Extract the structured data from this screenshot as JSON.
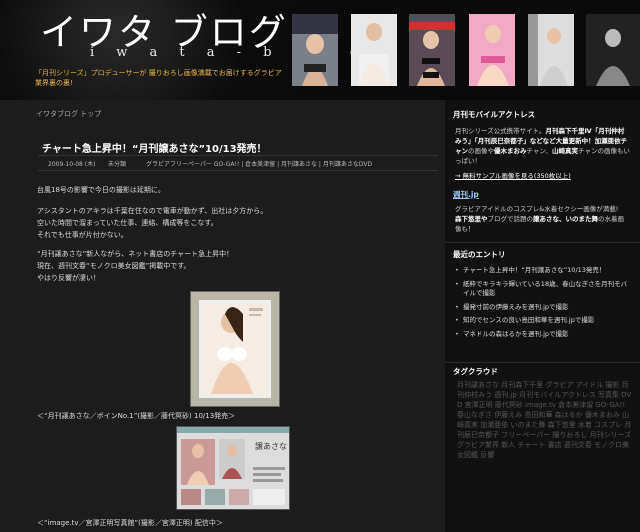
{
  "header": {
    "title": "イワタ ブログ",
    "subtitle": "i w a t a - b l o g",
    "description": "「月刊シリーズ」プロデューサーが 撮りおろし画像満載でお届けするグラビア業界裏の裏!"
  },
  "breadcrumb": "イワタブログ トップ",
  "post": {
    "title": "チャート急上昇中！“月刊譲あさな”10/13発売！",
    "date": "2009-10-08 (木)",
    "category": "未分類",
    "tags": "グラビアフリーペーパー GO-GA!! | 倉本美津留 | 月刊譲あさな | 月刊譲あさなDVD",
    "paragraphs": [
      "台風18号の影響で今日の撮影は延期に。",
      "アシスタントのアキラは千葉在住なので電車が動かず、出社は夕方から。",
      "空いた時間で溜まっていた仕事、連絡、構成等をこなす。",
      "それでも仕事が片付かない。",
      "“月刊譲あさな”新人ながら、ネット書店のチャート急上昇中！",
      "現在、週刊文春“モノクロ美女図鑑”掲載中です。",
      "やはり反響が凄い！"
    ],
    "caption1": "＜“月刊譲あさな／ボインNo.1”(撮影／藤代冥砂) 10/13発売＞",
    "caption2": "＜“image.tv／宮澤正明写真館”(撮影／宮澤正明) 配信中＞",
    "screenshot_name": "譲あさな"
  },
  "sidebar": {
    "mobile_heading": "月刊モバイルアクトレス",
    "mobile_text_1": "月刊シリーズ公式携帯サイト。",
    "mobile_text_bold": "月刊森下千里Ⅳ「月刊仲村みう」「月刊辰巳奈都子」などなど大量更新中！加瀬亜依チャン",
    "mobile_text_2": "の画像や",
    "mobile_text_bold2": "優木まおみ",
    "mobile_text_3": "チャン、",
    "mobile_text_bold3": "山崎真実",
    "mobile_text_4": "チャンの画像もいっぱい！",
    "mobile_link": "→ 無料サンプル画像を見る(350枚以上)",
    "weekly_link": "週刊.jp",
    "weekly_text_1": "グラビアアイドルのコスプレ&水着セクシー画像が満載!",
    "weekly_text_bold": "森下悠里や",
    "weekly_text_2": "ブログで話題の",
    "weekly_text_bold2": "譲あさな、いのまた舞",
    "weekly_text_3": "の水着画像も！",
    "recent_heading": "最近のエントリ",
    "recent": [
      "チャート急上昇中！“月刊譲あさな”10/13発売！",
      "紙粋でキラキラ輝いている18歳、春山なぎさを月刊モバイルで撮影",
      "撮発寸前の伊藤えみを週刊.jpで撮影",
      "知的でセンスの良い島田和華を週刊.jpで撮影",
      "マネドルの森はるかを週刊.jpで撮影"
    ],
    "tag_heading": "タグクラウド",
    "tagcloud": "月刊譲あさな 月刊森下千里 グラビア アイドル 撮影 月刊仲村みう 週刊.jp 月刊モバイルアクトレス 写真集 DVD 宮澤正明 藤代冥砂 image.tv 倉本美津留 GO-GA!! 春山なぎさ 伊藤えみ 島田和華 森はるか 優木まおみ 山崎真実 加瀬亜依 いのまた舞 森下悠里 水着 コスプレ 月刊辰巳奈都子 フリーペーパー 撮りおろし 月刊シリーズ グラビア業界 新人 チャート 書店 週刊文春 モノクロ美女図鑑 反響"
  },
  "colors": {
    "accent": "#e8b84a",
    "link": "#99ccff",
    "background": "#1c1c1c",
    "sidebar": "#111111"
  }
}
